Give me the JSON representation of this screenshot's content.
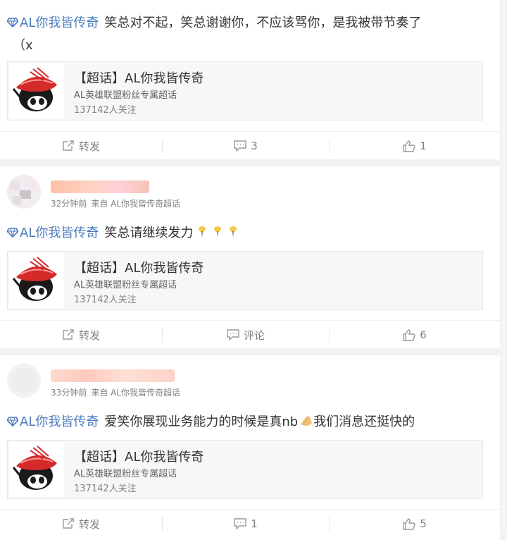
{
  "accent_colors": {
    "tag": "#4b7bbd",
    "meta": "#808080",
    "text": "#333333"
  },
  "posts": [
    {
      "super_topic_tag": "AL你我皆传奇",
      "text_line1": "笑总对不起，笑总谢谢你，不应该骂你，是我被带节奏了",
      "text_line2": "（x",
      "topic_card": {
        "title": "【超话】AL你我皆传奇",
        "subtitle": "AL英雄联盟粉丝专属超话",
        "followers": "137142人关注"
      },
      "actions": {
        "repost": "转发",
        "comment": "3",
        "like": "1"
      }
    },
    {
      "time": "32分钟前",
      "source": "来自 AL你我皆传奇超话",
      "super_topic_tag": "AL你我皆传奇",
      "text_line1": "笑总请继续发力",
      "emoji": "torch-emoji",
      "topic_card": {
        "title": "【超话】AL你我皆传奇",
        "subtitle": "AL英雄联盟粉丝专属超话",
        "followers": "137142人关注"
      },
      "actions": {
        "repost": "转发",
        "comment": "评论",
        "like": "6"
      }
    },
    {
      "time": "33分钟前",
      "source": "来自 AL你我皆传奇超话",
      "super_topic_tag": "AL你我皆传奇",
      "text_line1a": "爱笑你展现业务能力的时候是真nb",
      "emoji": "clap-emoji",
      "text_line1b": "我们消息还挺快的",
      "topic_card": {
        "title": "【超话】AL你我皆传奇",
        "subtitle": "AL英雄联盟粉丝专属超话",
        "followers": "137142人关注"
      },
      "actions": {
        "repost": "转发",
        "comment": "1",
        "like": "5"
      }
    }
  ]
}
